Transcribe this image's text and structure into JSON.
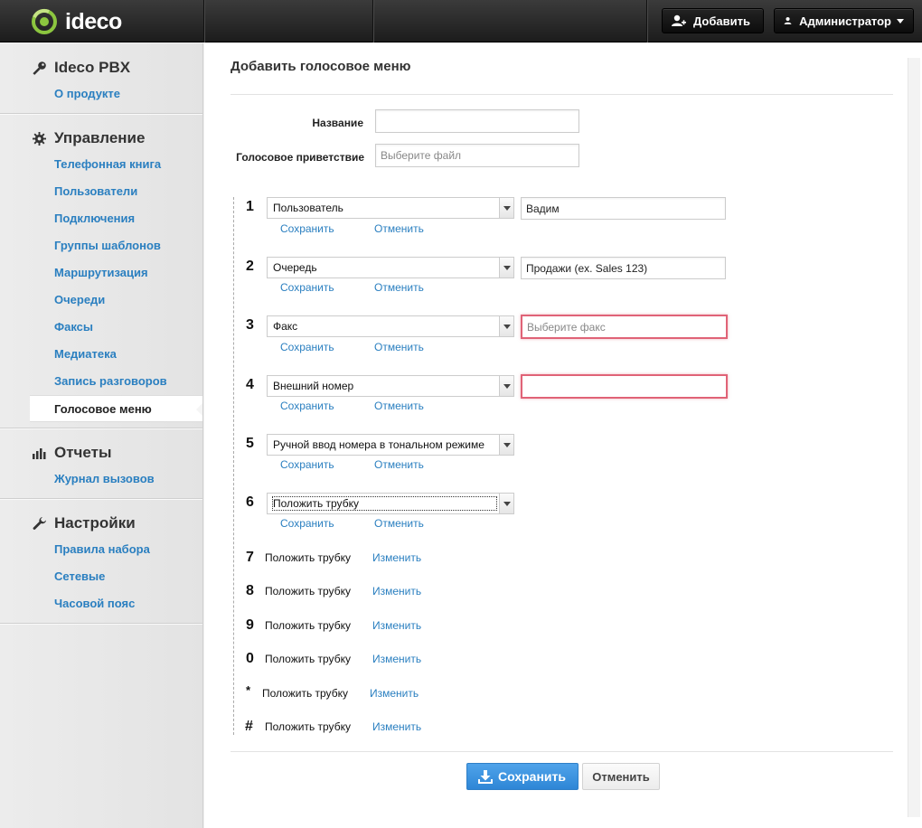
{
  "app": {
    "logo_text": "ideco"
  },
  "topbar": {
    "add_label": "Добавить",
    "admin_label": "Администратор"
  },
  "sidebar": {
    "sections": [
      {
        "title": "Ideco PBX",
        "icon": "key-icon",
        "items": [
          "О продукте"
        ]
      },
      {
        "title": "Управление",
        "icon": "gear-icon",
        "items": [
          "Телефонная книга",
          "Пользователи",
          "Подключения",
          "Группы шаблонов",
          "Маршрутизация",
          "Очереди",
          "Факсы",
          "Медиатека",
          "Запись разговоров",
          "Голосовое меню"
        ]
      },
      {
        "title": "Отчеты",
        "icon": "bar-chart-icon",
        "items": [
          "Журнал вызовов"
        ]
      },
      {
        "title": "Настройки",
        "icon": "wrench-icon",
        "items": [
          "Правила набора",
          "Сетевые",
          "Часовой пояс"
        ]
      }
    ],
    "active_item": "Голосовое меню"
  },
  "form": {
    "title": "Добавить голосовое меню",
    "name_label": "Название",
    "name_value": "",
    "greeting_label": "Голосовое приветствие",
    "greeting_placeholder": "Выберите файл"
  },
  "menu_items": [
    {
      "key": "1",
      "action": "Пользователь",
      "value": "Вадим ",
      "save": "Сохранить",
      "cancel": "Отменить"
    },
    {
      "key": "2",
      "action": "Очередь",
      "value": "Продажи (ex. Sales 123)",
      "save": "Сохранить",
      "cancel": "Отменить"
    },
    {
      "key": "3",
      "action": "Факс",
      "placeholder": "Выберите факс",
      "save": "Сохранить",
      "cancel": "Отменить"
    },
    {
      "key": "4",
      "action": "Внешний номер",
      "value": "",
      "save": "Сохранить",
      "cancel": "Отменить"
    },
    {
      "key": "5",
      "action": "Ручной ввод номера в тональном режиме",
      "save": "Сохранить",
      "cancel": "Отменить"
    },
    {
      "key": "6",
      "action": "Положить трубку",
      "save": "Сохранить",
      "cancel": "Отменить"
    },
    {
      "key": "7",
      "action": "Положить трубку",
      "edit": "Изменить"
    },
    {
      "key": "8",
      "action": "Положить трубку",
      "edit": "Изменить"
    },
    {
      "key": "9",
      "action": "Положить трубку",
      "edit": "Изменить"
    },
    {
      "key": "0",
      "action": "Положить трубку",
      "edit": "Изменить"
    },
    {
      "key": "*",
      "action": "Положить трубку",
      "edit": "Изменить"
    },
    {
      "key": "#",
      "action": "Положить трубку",
      "edit": "Изменить"
    }
  ],
  "footer": {
    "save_label": "Сохранить",
    "cancel_label": "Отменить"
  },
  "colors": {
    "link": "#2a7fc0",
    "primary": "#3a93e0",
    "error": "#e06377"
  }
}
